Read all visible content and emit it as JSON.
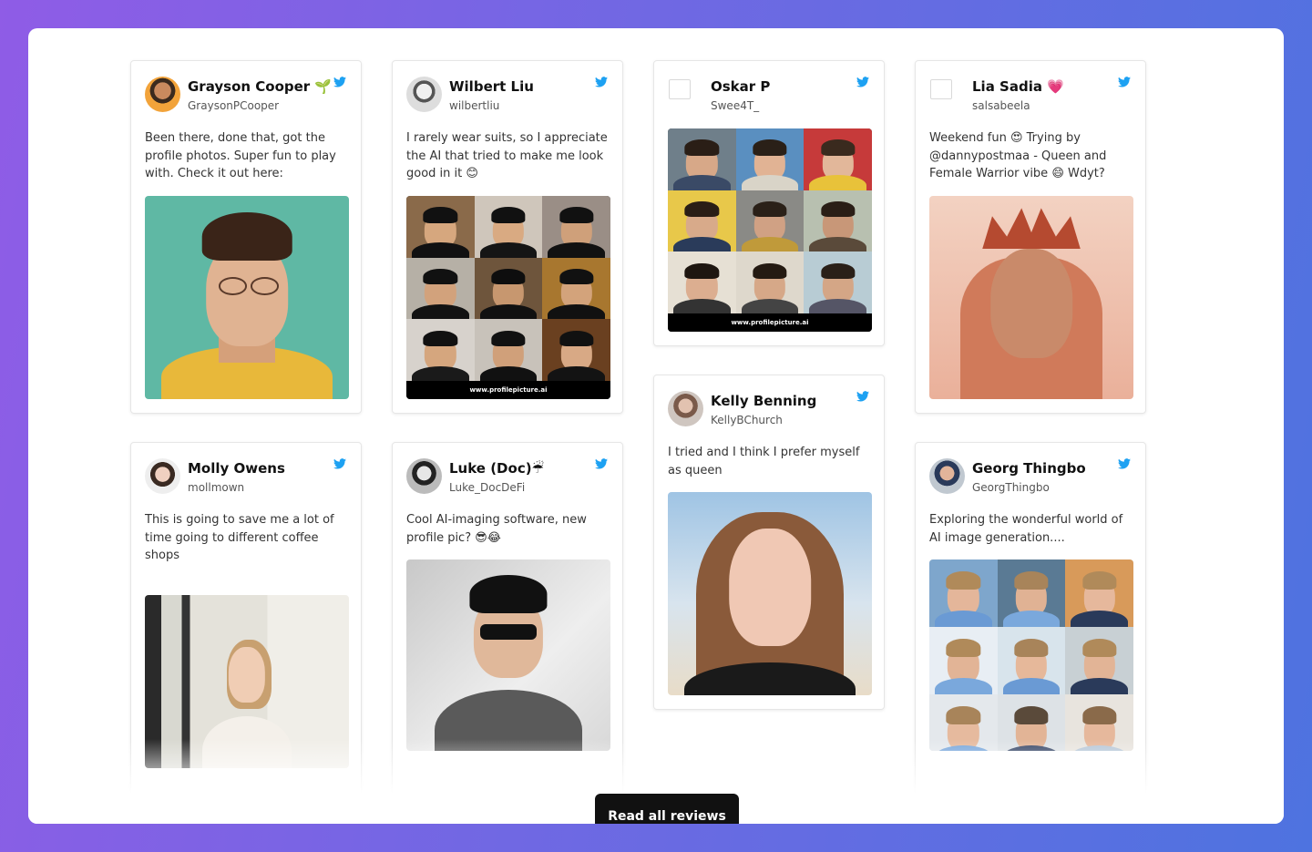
{
  "reviews": [
    {
      "name": "Grayson Cooper 🌱",
      "handle": "GraysonPCooper",
      "text": "Been there, done that, got the profile photos. Super fun to play with. Check it out here:"
    },
    {
      "name": "Wilbert Liu",
      "handle": "wilbertliu",
      "text": "I rarely wear suits, so I appreciate the AI that tried to make me look good in it 😊",
      "banner": "www.profilepicture.ai"
    },
    {
      "name": "Oskar P",
      "handle": "Swee4T_",
      "text": "",
      "banner": "www.profilepicture.ai"
    },
    {
      "name": "Lia Sadia 💗",
      "handle": "salsabeela",
      "text": "Weekend fun 😍 Trying by @dannypostmaa - Queen and Female Warrior vibe 😄 Wdyt?"
    },
    {
      "name": "Kelly Benning",
      "handle": "KellyBChurch",
      "text": "I tried and I think I prefer myself as queen"
    },
    {
      "name": "Molly Owens",
      "handle": "mollmown",
      "text": "This is going to save me a lot of time going to different coffee shops"
    },
    {
      "name": "Luke (Doc)☔",
      "handle": "Luke_DocDeFi",
      "text": "Cool AI-imaging software, new profile pic? 😎😂"
    },
    {
      "name": "Georg Thingbo",
      "handle": "GeorgThingbo",
      "text": "Exploring the wonderful world of AI image generation...."
    }
  ],
  "read_all_label": "Read all reviews",
  "colors": {
    "twitter_blue": "#1da1f2",
    "button": "#111111"
  }
}
